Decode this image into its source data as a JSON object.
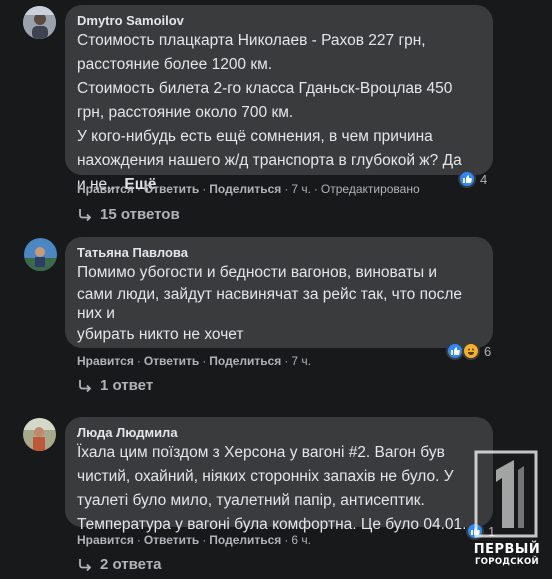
{
  "comments": [
    {
      "author": "Dmytro Samoilov",
      "lines": [
        "Стоимость плацкарта Николаев - Рахов 227 грн,",
        "расстояние более 1200 км.",
        "Стоимость билета 2-го класса Гданьск-Вроцлав 450",
        "грн, расстояние около 700 км.",
        "У кого-нибудь есть ещё сомнения, в чем причина",
        "нахождения нашего ж/д транспорта в глубокой ж? Да",
        "и не..."
      ],
      "more": "Ещё",
      "like": "Нравится",
      "reply": "Ответить",
      "share": "Поделиться",
      "time": "7 ч.",
      "edited": "Отредактировано",
      "reactions": "4",
      "replies": "15 ответов"
    },
    {
      "author": "Татьяна Павлова",
      "lines": [
        "Помимо убогости и бедности вагонов, виноваты и",
        "сами люди, зайдут насвинячат за рейс так, что после",
        "них и",
        "убирать никто не хочет"
      ],
      "like": "Нравится",
      "reply": "Ответить",
      "share": "Поделиться",
      "time": "7 ч.",
      "reactions": "6",
      "replies": "1 ответ"
    },
    {
      "author": "Люда Людмила",
      "lines": [
        "Їхала цим поїздом з Херсона у вагоні #2. Вагон був",
        "чистий, охайний, ніяких сторонніх запахів не було. У",
        "туалеті було мило, туалетний папір, антисептик.",
        "Температура у вагоні була комфортна. Це було 04.01."
      ],
      "like": "Нравится",
      "reply": "Ответить",
      "share": "Поделиться",
      "time": "6 ч.",
      "reactions": "1",
      "replies": "2 ответа"
    }
  ],
  "watermark": {
    "line1": "ПЕРВЫЙ",
    "line2": "ГОРОДСКОЙ"
  },
  "colors": {
    "background": "#18191a",
    "bubble": "#3a3b3c",
    "text": "#e4e6eb",
    "secondary": "#b0b3b8",
    "like": "#2d88ff"
  }
}
